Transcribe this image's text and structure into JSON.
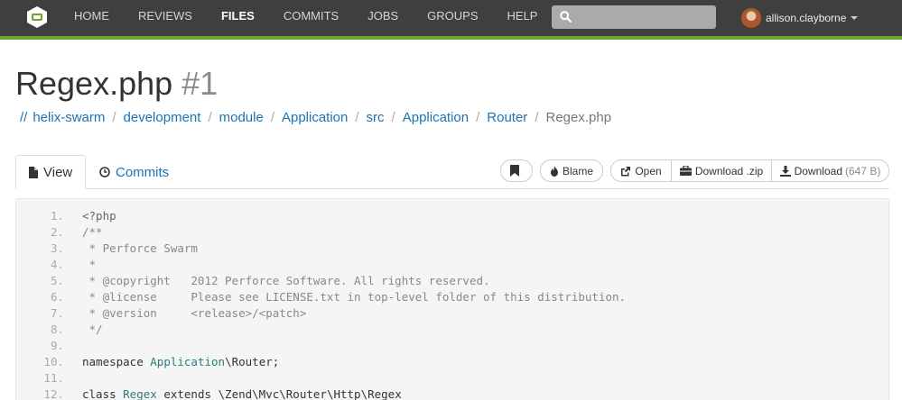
{
  "colors": {
    "navbar": "#3f3f3f",
    "accent": "#6ca52a",
    "link": "#1c74b3",
    "code_bg": "#f5f5f5"
  },
  "nav": {
    "logo_icon": "swarm-logo-icon",
    "items": [
      {
        "label": "HOME",
        "active": false
      },
      {
        "label": "REVIEWS",
        "active": false
      },
      {
        "label": "FILES",
        "active": true
      },
      {
        "label": "COMMITS",
        "active": false
      },
      {
        "label": "JOBS",
        "active": false
      },
      {
        "label": "GROUPS",
        "active": false
      },
      {
        "label": "HELP",
        "active": false
      }
    ],
    "search": {
      "placeholder": "",
      "value": ""
    },
    "user": {
      "name": "allison.clayborne"
    }
  },
  "page": {
    "file_name": "Regex.php",
    "revision": "#1"
  },
  "breadcrumb": {
    "depot_marker": "//",
    "items": [
      "helix-swarm",
      "development",
      "module",
      "Application",
      "src",
      "Application",
      "Router"
    ],
    "current": "Regex.php"
  },
  "tabs": {
    "view": "View",
    "commits": "Commits"
  },
  "toolbar": {
    "blame": "Blame",
    "open": "Open",
    "download_zip": "Download .zip",
    "download": "Download",
    "download_size": "(647 B)"
  },
  "code": {
    "lines": [
      {
        "no": "1.",
        "tokens": [
          {
            "t": "<?php",
            "c": "meta"
          }
        ]
      },
      {
        "no": "2.",
        "tokens": [
          {
            "t": "/**",
            "c": "comment"
          }
        ]
      },
      {
        "no": "3.",
        "tokens": [
          {
            "t": " * Perforce Swarm",
            "c": "comment"
          }
        ]
      },
      {
        "no": "4.",
        "tokens": [
          {
            "t": " *",
            "c": "comment"
          }
        ]
      },
      {
        "no": "5.",
        "tokens": [
          {
            "t": " * @copyright   2012 Perforce Software. All rights reserved.",
            "c": "comment"
          }
        ]
      },
      {
        "no": "6.",
        "tokens": [
          {
            "t": " * @license     Please see LICENSE.txt in top-level folder of this distribution.",
            "c": "comment"
          }
        ]
      },
      {
        "no": "7.",
        "tokens": [
          {
            "t": " * @version     <release>/<patch>",
            "c": "comment"
          }
        ]
      },
      {
        "no": "8.",
        "tokens": [
          {
            "t": " */",
            "c": "comment"
          }
        ]
      },
      {
        "no": "9.",
        "tokens": []
      },
      {
        "no": "10.",
        "tokens": [
          {
            "t": "namespace ",
            "c": "plain"
          },
          {
            "t": "Application",
            "c": "name"
          },
          {
            "t": "\\Router;",
            "c": "plain"
          }
        ]
      },
      {
        "no": "11.",
        "tokens": []
      },
      {
        "no": "12.",
        "tokens": [
          {
            "t": "class ",
            "c": "plain"
          },
          {
            "t": "Regex",
            "c": "name"
          },
          {
            "t": " extends \\Zend\\Mvc\\Router\\Http\\Regex",
            "c": "plain"
          }
        ]
      }
    ]
  }
}
